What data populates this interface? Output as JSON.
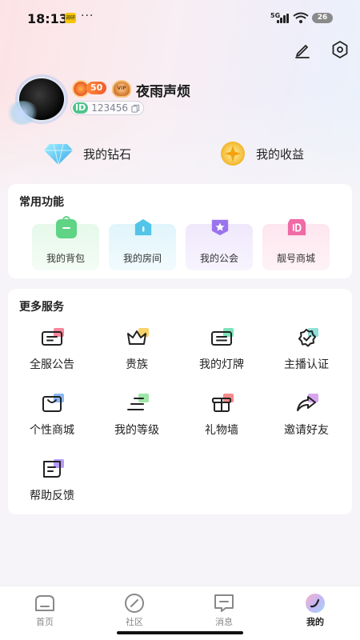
{
  "status_bar": {
    "time": "18:13",
    "notif_badge": "调研",
    "more": "···",
    "network": "5G",
    "battery": "26"
  },
  "profile": {
    "level": "50",
    "vip_badge": "VIP",
    "nickname": "夜雨声烦",
    "id_tag": "ID",
    "id_number": "123456"
  },
  "assets": {
    "diamonds_label": "我的钻石",
    "earnings_label": "我的收益"
  },
  "common_functions": {
    "title": "常用功能",
    "items": [
      {
        "label": "我的背包",
        "icon": "backpack-icon",
        "color": "#6fd98a"
      },
      {
        "label": "我的房间",
        "icon": "room-icon",
        "color": "#5ac8e6"
      },
      {
        "label": "我的公会",
        "icon": "guild-icon",
        "color": "#9b7ef0"
      },
      {
        "label": "靓号商城",
        "icon": "pretty-id-icon",
        "color": "#f06fa8"
      }
    ]
  },
  "more_services": {
    "title": "更多服务",
    "items": [
      {
        "label": "全服公告",
        "icon": "announcement-icon"
      },
      {
        "label": "贵族",
        "icon": "crown-icon"
      },
      {
        "label": "我的灯牌",
        "icon": "light-sign-icon"
      },
      {
        "label": "主播认证",
        "icon": "verified-icon"
      },
      {
        "label": "个性商城",
        "icon": "shop-bag-icon"
      },
      {
        "label": "我的等级",
        "icon": "level-icon"
      },
      {
        "label": "礼物墙",
        "icon": "gift-icon"
      },
      {
        "label": "邀请好友",
        "icon": "share-icon"
      },
      {
        "label": "帮助反馈",
        "icon": "feedback-icon"
      }
    ]
  },
  "nav": {
    "items": [
      {
        "label": "首页",
        "icon": "home-icon"
      },
      {
        "label": "社区",
        "icon": "community-icon"
      },
      {
        "label": "消息",
        "icon": "message-icon"
      },
      {
        "label": "我的",
        "icon": "profile-icon"
      }
    ],
    "active_index": 3
  },
  "colors": {
    "accent_pink": "#f66f8a",
    "accent_blue": "#6fb8f3",
    "accent_purple": "#b58bf2",
    "level_orange": "#f25a2a"
  }
}
